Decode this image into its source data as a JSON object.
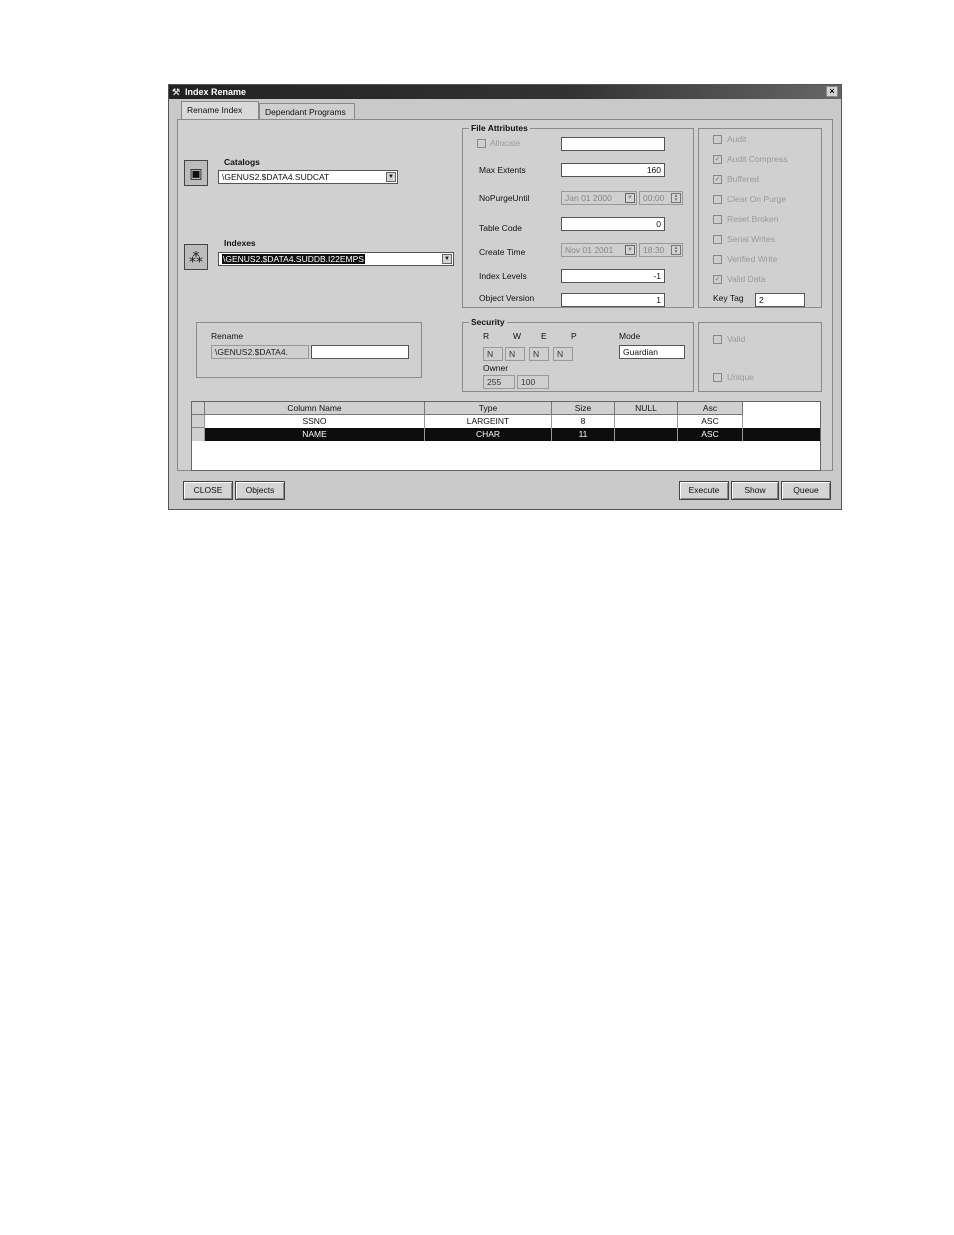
{
  "window": {
    "title": "Index Rename",
    "close_glyph": "×"
  },
  "tabs": [
    {
      "label": "Rename Index",
      "mnemonic_index": 7
    },
    {
      "label": "Dependant Programs"
    }
  ],
  "catalogs": {
    "label": "Catalogs",
    "value": "\\GENUS2.$DATA4.SUDCAT"
  },
  "indexes": {
    "label": "Indexes",
    "value": "\\GENUS2.$DATA4.SUDDB.I22EMPS"
  },
  "rename": {
    "label": "Rename",
    "prefix": "\\GENUS2.$DATA4.",
    "value": ""
  },
  "file_attributes": {
    "title": "File Attributes",
    "allocate": {
      "label": "Allocate",
      "value": ""
    },
    "max_extents": {
      "label": "Max Extents",
      "value": "160"
    },
    "no_purge_until": {
      "label": "NoPurgeUntil",
      "date": "Jan 01 2000",
      "time": "00:00"
    },
    "table_code": {
      "label": "Table Code",
      "value": "0"
    },
    "create_time": {
      "label": "Create Time",
      "date": "Nov 01 2001",
      "time": "18:30"
    },
    "index_levels": {
      "label": "Index Levels",
      "value": "-1"
    },
    "object_version": {
      "label": "Object Version",
      "value": "1"
    }
  },
  "options": [
    {
      "label": "Audit",
      "checked": false
    },
    {
      "label": "Audit Compress",
      "checked": true
    },
    {
      "label": "Buffered",
      "checked": true
    },
    {
      "label": "Clear On Purge",
      "checked": false
    },
    {
      "label": "Reset Broken",
      "checked": false
    },
    {
      "label": "Serial Writes",
      "checked": false
    },
    {
      "label": "Verified Write",
      "checked": false
    },
    {
      "label": "Valid Data",
      "checked": true
    }
  ],
  "key_tag": {
    "label": "Key Tag",
    "value": "2"
  },
  "security": {
    "title": "Security",
    "cols": [
      "R",
      "W",
      "E",
      "P"
    ],
    "values": [
      "N",
      "N",
      "N",
      "N"
    ],
    "mode_label": "Mode",
    "mode_value": "Guardian",
    "owner_label": "Owner",
    "owner_group": "255",
    "owner_user": "100"
  },
  "flags": [
    {
      "label": "Valid",
      "checked": false
    },
    {
      "label": "Unique",
      "checked": false
    }
  ],
  "grid": {
    "headers": [
      "Column Name",
      "Type",
      "Size",
      "NULL",
      "Asc"
    ],
    "rows": [
      {
        "name": "SSNO",
        "type": "LARGEINT",
        "size": "8",
        "null": "",
        "asc": "ASC"
      },
      {
        "name": "NAME",
        "type": "CHAR",
        "size": "11",
        "null": "",
        "asc": "ASC"
      }
    ]
  },
  "buttons": {
    "close": "CLOSE",
    "objects": "Objects",
    "execute": "Execute",
    "show": "Show",
    "queue": "Queue"
  }
}
